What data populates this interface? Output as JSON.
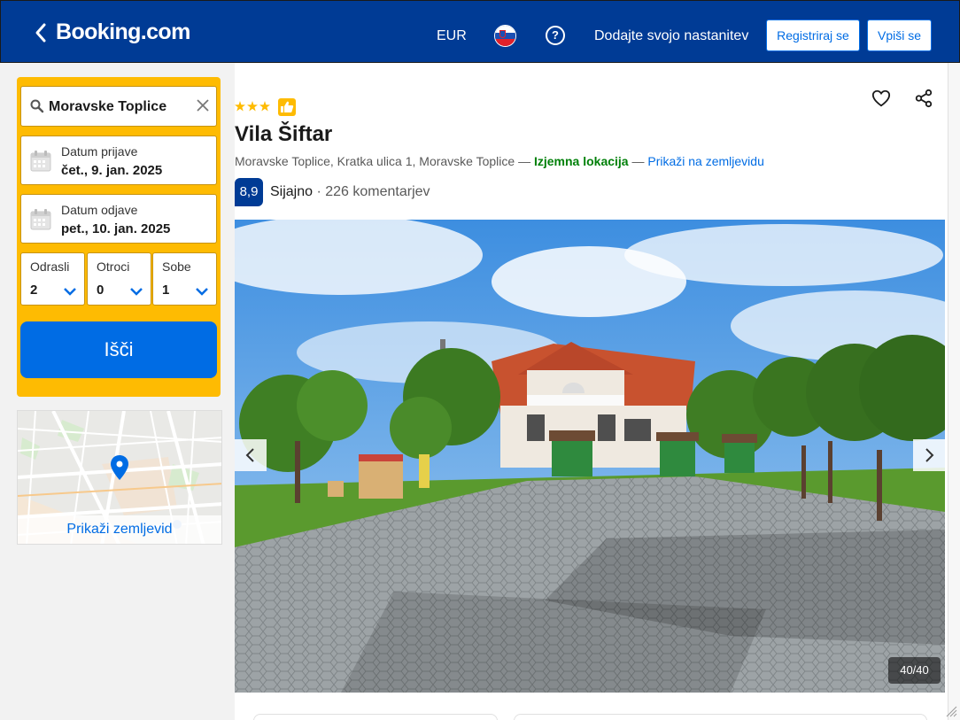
{
  "header": {
    "logo": "Booking.com",
    "currency": "EUR",
    "add_property": "Dodajte svojo nastanitev",
    "register": "Registriraj se",
    "login": "Vpiši se"
  },
  "search": {
    "destination": "Moravske Toplice",
    "checkin_label": "Datum prijave",
    "checkin_value": "čet., 9. jan. 2025",
    "checkout_label": "Datum odjave",
    "checkout_value": "pet., 10. jan. 2025",
    "adults_label": "Odrasli",
    "adults_value": "2",
    "children_label": "Otroci",
    "children_value": "0",
    "rooms_label": "Sobe",
    "rooms_value": "1",
    "search_button": "Išči"
  },
  "map": {
    "link": "Prikaži zemljevid"
  },
  "property": {
    "star_rating": 3,
    "name": "Vila Šiftar",
    "address": "Moravske Toplice, Kratka ulica 1, Moravske Toplice",
    "dash1": " — ",
    "location_badge": "Izjemna lokacija",
    "dash2": " — ",
    "map_link": "Prikaži na zemljevidu",
    "score": "8,9",
    "score_word": "Sijajno",
    "review_count": " · 226 komentarjev",
    "photo_counter": "40/40"
  },
  "colors": {
    "brand_blue": "#003b95",
    "search_yellow": "#febb02",
    "action_blue": "#006ce4",
    "location_green": "#008009"
  },
  "icons": [
    "back-icon",
    "flag-si-icon",
    "help-icon",
    "search-icon",
    "clear-icon",
    "calendar-icon",
    "chevron-down-icon",
    "map-pin-icon",
    "star-icon",
    "thumbs-up-icon",
    "heart-icon",
    "share-icon",
    "chevron-left-icon",
    "chevron-right-icon"
  ]
}
